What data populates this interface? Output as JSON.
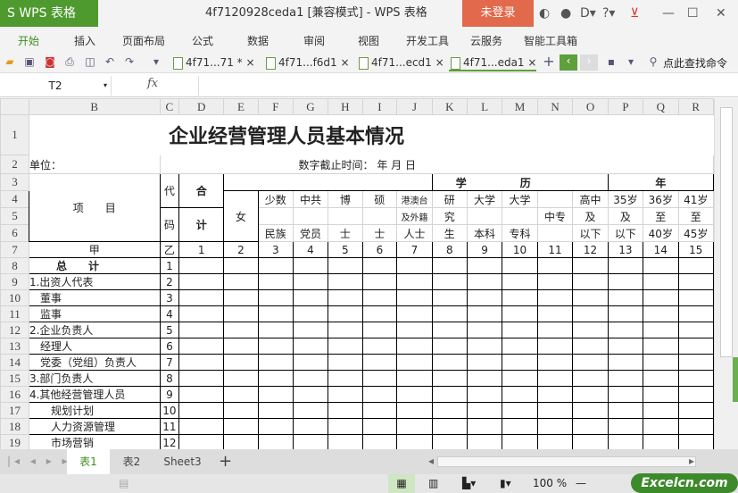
{
  "app": {
    "logo": "S WPS 表格",
    "title": "4f7120928ceda1 [兼容模式] - WPS 表格",
    "login": "未登录"
  },
  "menu": [
    "开始",
    "插入",
    "页面布局",
    "公式",
    "数据",
    "审阅",
    "视图",
    "开发工具",
    "云服务",
    "智能工具箱"
  ],
  "doc_tabs": [
    "4f71...71 * ×",
    "4f71...f6d1 ×",
    "4f71...ecd1 ×",
    "4f71...eda1 ×"
  ],
  "search_cmd": "点此查找命令",
  "name_box": "T2",
  "fx": "fx",
  "columns": [
    "B",
    "C",
    "D",
    "E",
    "F",
    "G",
    "H",
    "I",
    "J",
    "K",
    "L",
    "M",
    "N",
    "O",
    "P",
    "Q",
    "R"
  ],
  "rows": [
    "1",
    "2",
    "3",
    "4",
    "5",
    "6",
    "7",
    "8",
    "9",
    "10",
    "11",
    "12",
    "13",
    "14",
    "15",
    "16",
    "17",
    "18",
    "19"
  ],
  "sheet": {
    "title": "企业经营管理人员基本情况",
    "unit": "单位：",
    "date_label": "数字截止时间：  年  月  日",
    "h_item": "项　　目",
    "h_dai": "代",
    "h_ma": "码",
    "h_he": "合",
    "h_ji": "计",
    "h_xue": "学",
    "h_li": "历",
    "h_nian": "年",
    "h_nv": "女",
    "h4": [
      "少数",
      "中共",
      "博",
      "硕",
      "港澳台",
      "研",
      "大学",
      "大学",
      "",
      "高中",
      "35岁",
      "36岁",
      "41岁"
    ],
    "h5": [
      "",
      "",
      "",
      "",
      "及外籍",
      "究",
      "",
      "",
      "中专",
      "及",
      "及",
      "至",
      "至"
    ],
    "h6": [
      "民族",
      "党员",
      "士",
      "士",
      "人士",
      "生",
      "本科",
      "专科",
      "",
      "以下",
      "以下",
      "40岁",
      "45岁"
    ],
    "row7": [
      "甲",
      "乙",
      "1",
      "2",
      "3",
      "4",
      "5",
      "6",
      "7",
      "8",
      "9",
      "10",
      "11",
      "12",
      "13",
      "14",
      "15"
    ],
    "items": [
      {
        "label": "总　　计",
        "code": "1"
      },
      {
        "label": "1.出资人代表",
        "code": "2"
      },
      {
        "label": "　董事",
        "code": "3"
      },
      {
        "label": "　监事",
        "code": "4"
      },
      {
        "label": "2.企业负责人",
        "code": "5"
      },
      {
        "label": "　经理人",
        "code": "6"
      },
      {
        "label": "　党委（党组）负责人",
        "code": "7"
      },
      {
        "label": "3.部门负责人",
        "code": "8"
      },
      {
        "label": "4.其他经营管理人员",
        "code": "9"
      },
      {
        "label": "　　规划计划",
        "code": "10"
      },
      {
        "label": "　　人力资源管理",
        "code": "11"
      },
      {
        "label": "　　市场营销",
        "code": "12"
      }
    ]
  },
  "sheet_tabs": [
    "表1",
    "表2",
    "Sheet3"
  ],
  "zoom": "100 %",
  "watermark": "Excelcn.com"
}
